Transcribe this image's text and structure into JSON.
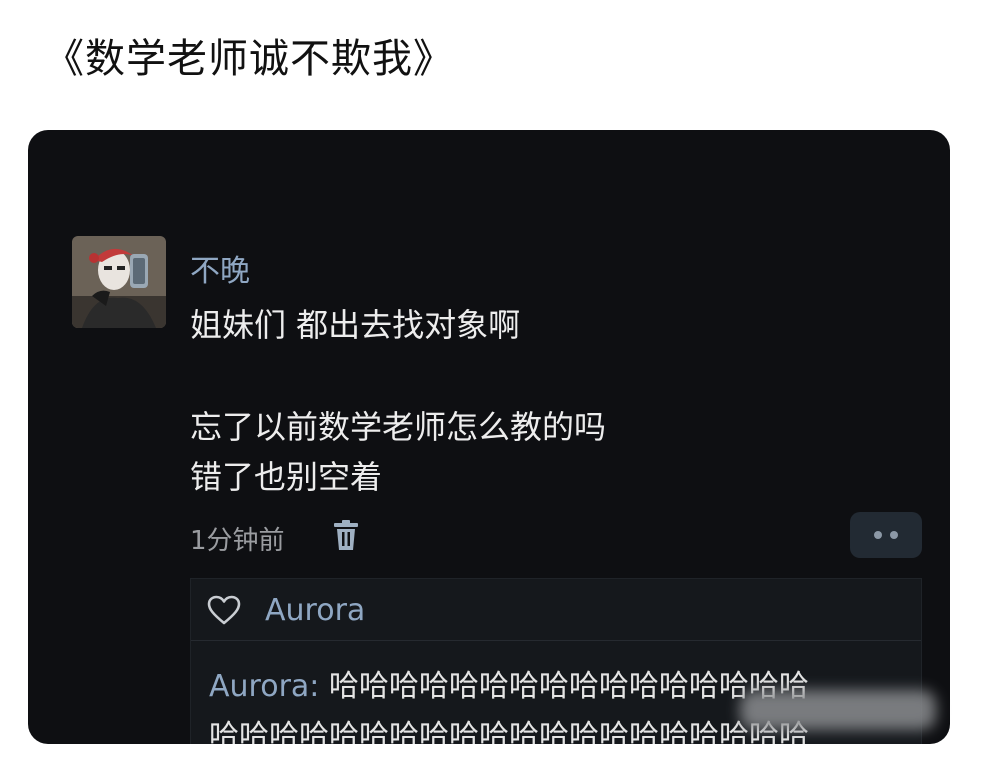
{
  "page": {
    "title": "《数学老师诚不欺我》"
  },
  "comment": {
    "username": "不晚",
    "lines": [
      "姐妹们 都出去找对象啊",
      "忘了以前数学老师怎么教的吗",
      "错了也别空着"
    ],
    "timestamp": "1分钟前",
    "icons": {
      "delete": "trash-icon",
      "more": "more-icon"
    }
  },
  "reply": {
    "like_name": "Aurora",
    "author": "Aurora:",
    "line1_text": " 哈哈哈哈哈哈哈哈哈哈哈哈哈哈哈哈",
    "line2_text": "哈哈哈哈哈哈哈哈哈哈哈哈哈哈哈哈哈哈哈哈",
    "icons": {
      "like": "heart-icon"
    }
  },
  "colors": {
    "card_bg": "#0e0f12",
    "name_accent": "#8fa7c3",
    "text": "#ededed"
  }
}
